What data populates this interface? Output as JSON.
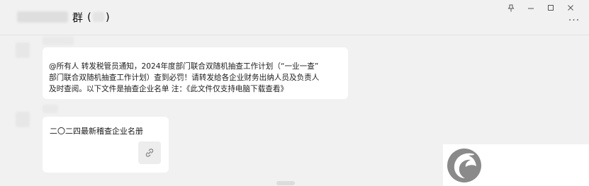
{
  "window": {
    "title_main": "群",
    "title_open": "(",
    "title_close": ")",
    "controls": {
      "pin": "⚲",
      "minimize": "—",
      "maximize": "☐",
      "close": "✕"
    },
    "more": "···"
  },
  "messages": [
    {
      "type": "text",
      "lines": [
        "@所有人 转发税管员通知，2024年度部门联合双随机抽查工作计划（“一业一查”",
        "部门联合双随机抽查工作计划）查到必罚！请转发给各企业财务出纳人员及负责人",
        "及时查阅。以下文件是抽查企业名单 注：《此文件仅支持电脑下载查看》"
      ]
    },
    {
      "type": "link",
      "title": "二〇二四最新稽查企业名册",
      "icon": "link-icon"
    }
  ],
  "colors": {
    "background": "#f1f1f1",
    "bubble": "#ffffff",
    "logo": "#8a8a8a"
  },
  "icons": [
    "pin-icon",
    "minimize-icon",
    "maximize-icon",
    "close-icon",
    "more-icon",
    "link-icon",
    "watermark-logo"
  ]
}
